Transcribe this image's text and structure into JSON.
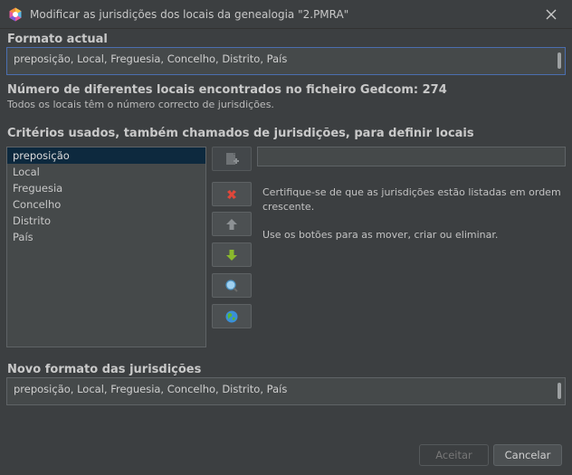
{
  "window": {
    "title": "Modificar as jurisdições dos locais da genealogia \"2.PMRA\"",
    "app_icon": "hexagon-app-icon",
    "close_icon": "close-icon"
  },
  "current_format": {
    "label": "Formato actual",
    "value": "preposição, Local, Freguesia, Concelho, Distrito, País"
  },
  "places_count": {
    "label": "Número de diferentes locais encontrados no ficheiro Gedcom: 274",
    "note": "Todos os locais têm o número correcto de jurisdições."
  },
  "criteria": {
    "label": "Critérios usados, também chamados de jurisdições, para definir locais",
    "items": [
      "preposição",
      "Local",
      "Freguesia",
      "Concelho",
      "Distrito",
      "País"
    ],
    "selected_index": 0,
    "new_jurisdiction_value": ""
  },
  "tools": {
    "add_icon": "add-jurisdiction-icon",
    "delete_icon": "delete-red-x-icon",
    "move_up_icon": "arrow-up-icon",
    "move_down_icon": "arrow-down-green-icon",
    "search_icon": "magnifier-icon",
    "globe_icon": "globe-icon"
  },
  "help": {
    "line1": "Certifique-se de que as jurisdições estão listadas em ordem",
    "line2": "crescente.",
    "line3": "Use os botões para as mover, criar ou eliminar."
  },
  "new_format": {
    "label": "Novo formato das jurisdições",
    "value": "preposição, Local, Freguesia, Concelho, Distrito, País"
  },
  "buttons": {
    "accept": "Aceitar",
    "cancel": "Cancelar"
  },
  "colors": {
    "background": "#3c3f41",
    "selection": "#0d293e",
    "focus_border": "#4b6eaf",
    "delete_red": "#e0473a",
    "move_down_green": "#8ab92d"
  }
}
